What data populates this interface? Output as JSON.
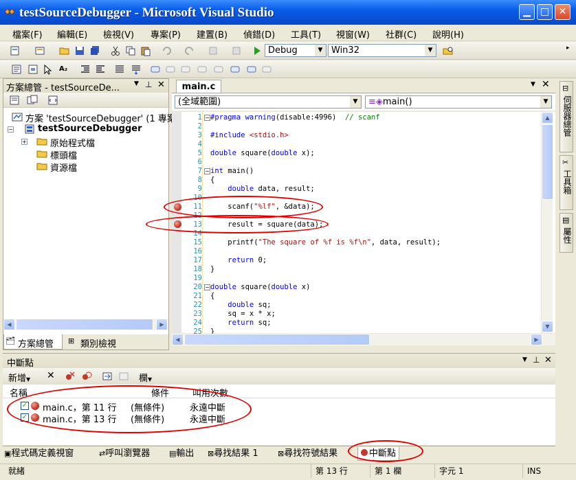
{
  "window": {
    "title": "testSourceDebugger - Microsoft Visual Studio"
  },
  "menu": [
    "檔案(F)",
    "編輯(E)",
    "檢視(V)",
    "專案(P)",
    "建置(B)",
    "偵錯(D)",
    "工具(T)",
    "視窗(W)",
    "社群(C)",
    "說明(H)"
  ],
  "toolbar": {
    "config": "Debug",
    "platform": "Win32"
  },
  "solution_explorer": {
    "title": "方案總管 - testSourceDe...",
    "solution": "方案 'testSourceDebugger' (1 專案)",
    "project": "testSourceDebugger",
    "folders": [
      "原始程式檔",
      "標頭檔",
      "資源檔"
    ],
    "tabs": [
      "方案總管",
      "類別檢視"
    ]
  },
  "editor": {
    "tab": "main.c",
    "scope": "(全域範圍)",
    "function": "main()",
    "lines": [
      {
        "n": "1",
        "parts": [
          [
            "kw",
            "#pragma warning"
          ],
          [
            "",
            "(disable:4996)  "
          ],
          [
            "cm",
            "// scanf"
          ]
        ]
      },
      {
        "n": "2",
        "parts": []
      },
      {
        "n": "3",
        "parts": [
          [
            "kw",
            "#include"
          ],
          [
            "str",
            " <stdio.h>"
          ]
        ]
      },
      {
        "n": "4",
        "parts": []
      },
      {
        "n": "5",
        "parts": [
          [
            "kw",
            "double"
          ],
          [
            "",
            " square("
          ],
          [
            "kw",
            "double"
          ],
          [
            "",
            " x);"
          ]
        ]
      },
      {
        "n": "6",
        "parts": []
      },
      {
        "n": "7",
        "parts": [
          [
            "kw",
            "int"
          ],
          [
            "",
            " main()"
          ]
        ]
      },
      {
        "n": "8",
        "parts": [
          [
            "",
            "{"
          ]
        ]
      },
      {
        "n": "9",
        "parts": [
          [
            "",
            "    "
          ],
          [
            "kw",
            "double"
          ],
          [
            "",
            " data, result;"
          ]
        ]
      },
      {
        "n": "10",
        "parts": []
      },
      {
        "n": "11",
        "parts": [
          [
            "",
            "    scanf("
          ],
          [
            "str",
            "\"%lf\""
          ],
          [
            "",
            ", &data);"
          ]
        ]
      },
      {
        "n": "12",
        "parts": []
      },
      {
        "n": "13",
        "parts": [
          [
            "",
            "    result = square(data);"
          ]
        ]
      },
      {
        "n": "14",
        "parts": []
      },
      {
        "n": "15",
        "parts": [
          [
            "",
            "    printf("
          ],
          [
            "str",
            "\"The square of %f is %f\\n\""
          ],
          [
            "",
            ", data, result);"
          ]
        ]
      },
      {
        "n": "16",
        "parts": []
      },
      {
        "n": "17",
        "parts": [
          [
            "",
            "    "
          ],
          [
            "kw",
            "return"
          ],
          [
            "",
            " 0;"
          ]
        ]
      },
      {
        "n": "18",
        "parts": [
          [
            "",
            "}"
          ]
        ]
      },
      {
        "n": "19",
        "parts": []
      },
      {
        "n": "20",
        "parts": [
          [
            "kw",
            "double"
          ],
          [
            "",
            " square("
          ],
          [
            "kw",
            "double"
          ],
          [
            "",
            " x)"
          ]
        ]
      },
      {
        "n": "21",
        "parts": [
          [
            "",
            "{"
          ]
        ]
      },
      {
        "n": "22",
        "parts": [
          [
            "",
            "    "
          ],
          [
            "kw",
            "double"
          ],
          [
            "",
            " sq;"
          ]
        ]
      },
      {
        "n": "23",
        "parts": [
          [
            "",
            "    sq = x * x;"
          ]
        ]
      },
      {
        "n": "24",
        "parts": [
          [
            "",
            "    "
          ],
          [
            "kw",
            "return"
          ],
          [
            "",
            " sq;"
          ]
        ]
      },
      {
        "n": "25",
        "parts": [
          [
            "",
            "}"
          ]
        ]
      }
    ]
  },
  "right_sidebar": [
    "伺服器總管",
    "工具箱",
    "屬性"
  ],
  "breakpoints": {
    "title": "中斷點",
    "new_label": "新增",
    "columns_label": "欄",
    "headers": [
      "名稱",
      "條件",
      "叫用次數"
    ],
    "rows": [
      {
        "name": "main.c，第 11 行",
        "condition": "(無條件)",
        "hits": "永遠中斷"
      },
      {
        "name": "main.c，第 13 行",
        "condition": "(無條件)",
        "hits": "永遠中斷"
      }
    ]
  },
  "bottom_tabs": [
    "程式碼定義視窗",
    "呼叫瀏覽器",
    "輸出",
    "尋找結果 1",
    "尋找符號結果",
    "中斷點"
  ],
  "status": {
    "ready": "就緒",
    "line": "第 13 行",
    "col": "第 1 欄",
    "char": "字元 1",
    "mode": "INS"
  }
}
